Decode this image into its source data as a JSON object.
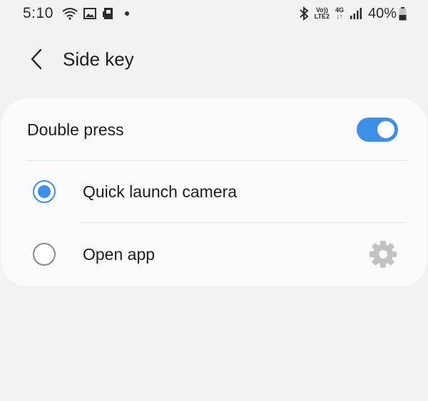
{
  "status_bar": {
    "time": "5:10",
    "lte_top": "Vo))",
    "lte_bottom": "LTE2",
    "network_top": "4G",
    "network_bottom": "↓↑",
    "battery_percent": "40%"
  },
  "header": {
    "title": "Side key"
  },
  "card": {
    "toggle_label": "Double press",
    "toggle_on": true,
    "options": [
      {
        "label": "Quick launch camera",
        "selected": true
      },
      {
        "label": "Open app",
        "selected": false
      }
    ]
  },
  "colors": {
    "accent": "#3e8fe8",
    "background": "#f2f2f2",
    "card": "#fbfbfb"
  }
}
